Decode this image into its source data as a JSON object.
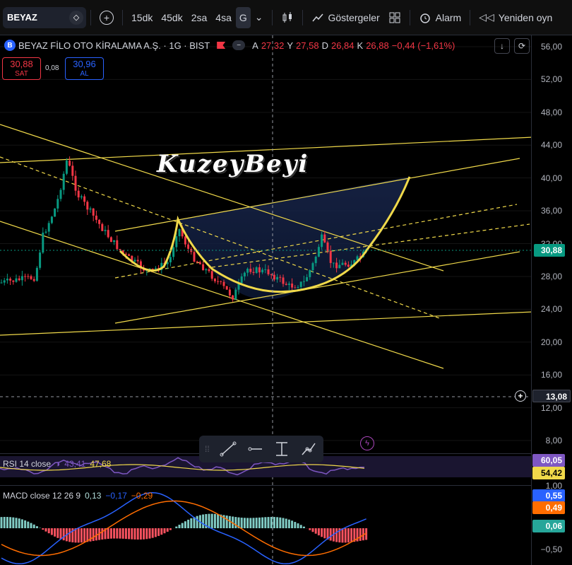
{
  "toolbar": {
    "symbol": "BEYAZ",
    "intervals": [
      "15dk",
      "45dk",
      "2sa",
      "4sa",
      "G"
    ],
    "indicators_label": "Göstergeler",
    "alarm_label": "Alarm",
    "replay_label": "Yeniden oyn"
  },
  "legend": {
    "title": "BEYAZ FİLO OTO KİRALAMA A.Ş. · 1G · BIST",
    "o_label": "A",
    "o_value": "27,32",
    "h_label": "Y",
    "h_value": "27,58",
    "l_label": "D",
    "l_value": "26,84",
    "c_label": "K",
    "c_value": "26,88",
    "change": "−0,44 (−1,61%)"
  },
  "trade": {
    "sell_price": "30,88",
    "sell_label": "SAT",
    "spread": "0,08",
    "buy_price": "30,96",
    "buy_label": "AL"
  },
  "watermark": "KuzeyBeyi",
  "price_axis": {
    "ticks": [
      "56,00",
      "52,00",
      "48,00",
      "44,00",
      "40,00",
      "36,00",
      "32,00",
      "28,00",
      "24,00",
      "20,00",
      "16,00",
      "12,00",
      "8,00"
    ],
    "last_price": "30,88",
    "crosshair_price": "13,08"
  },
  "rsi": {
    "label": "RSI 14 close",
    "value1": "43,41",
    "value2": "47,68",
    "axis_pill1": "60,05",
    "axis_pill2": "54,42"
  },
  "macd": {
    "label": "MACD close 12 26 9",
    "hist": "0,13",
    "macd": "−0,17",
    "signal": "−0,29",
    "axis_top": "1,00",
    "axis_bottom": "−0,50",
    "pill_macd": "0,55",
    "pill_signal": "0,49",
    "pill_hist": "0,06"
  },
  "colors": {
    "up": "#089981",
    "down": "#f23645",
    "trendline": "#f0d94a",
    "rsi_line": "#7e57c2",
    "macd_line": "#2962ff",
    "signal_line": "#ff6d00"
  }
}
